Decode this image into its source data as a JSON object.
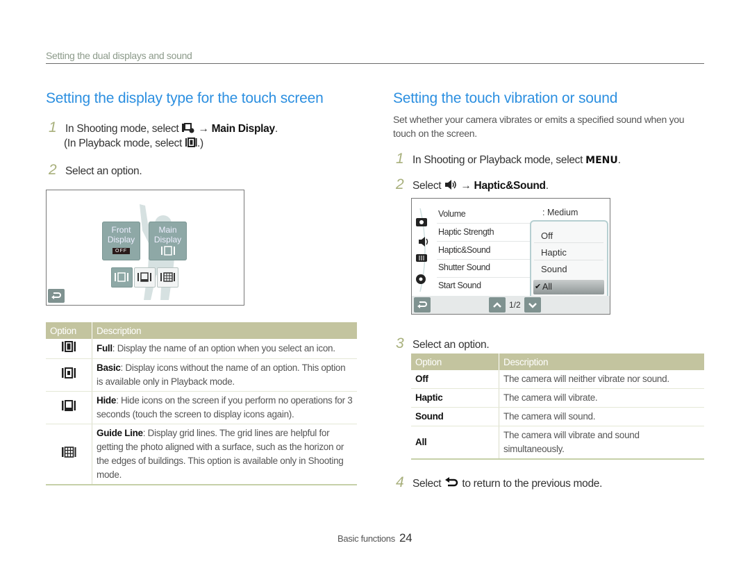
{
  "page": {
    "section_header": "Setting the dual displays and sound",
    "footer": {
      "label": "Basic functions",
      "page_number": "24"
    }
  },
  "left": {
    "title": "Setting the display type for the touch screen",
    "steps": [
      {
        "num": "1",
        "text_a": "In Shooting mode, select",
        "arrow": "→",
        "bold": "Main Display",
        "end": ".",
        "line2_a": "(In Playback mode, select",
        "line2_end": ".)"
      },
      {
        "num": "2",
        "text": "Select an option."
      }
    ],
    "screen": {
      "tiles": [
        {
          "label_1": "Front",
          "label_2": "Display",
          "badge": "OFF"
        },
        {
          "label_1": "Main",
          "label_2": "Display"
        }
      ],
      "option_icons": [
        "full-display-icon",
        "hide-display-icon",
        "guide-line-icon"
      ],
      "back_icon": "back-icon"
    },
    "table": {
      "headers": [
        "Option",
        "Description"
      ],
      "rows": [
        {
          "icon": "full-display-icon",
          "bold": "Full",
          "text": ": Display the name of an option when you select an icon."
        },
        {
          "icon": "basic-display-icon",
          "bold": "Basic",
          "text": ": Display icons without the name of an option. This option is available only in Playback mode."
        },
        {
          "icon": "hide-display-icon",
          "bold": "Hide",
          "text": ": Hide icons on the screen if you perform no operations for 3 seconds (touch the screen to display icons again)."
        },
        {
          "icon": "guide-line-icon",
          "bold": "Guide Line",
          "text": ": Display grid lines. The grid lines are helpful for getting the photo aligned with a surface, such as the horizon or the edges of buildings. This option is available only in Shooting mode."
        }
      ]
    }
  },
  "right": {
    "title": "Setting the touch vibration or sound",
    "intro": "Set whether your camera vibrates or emits a specified sound when you touch on the screen.",
    "steps": [
      {
        "num": "1",
        "text": "In Shooting or Playback mode, select",
        "glyph": "MENU",
        "end": "."
      },
      {
        "num": "2",
        "text": "Select",
        "arrow": "→",
        "bold": "Haptic&Sound",
        "end": "."
      },
      {
        "num": "3",
        "text": "Select an option."
      },
      {
        "num": "4",
        "text_a": "Select",
        "text_b": "to return to the previous mode."
      }
    ],
    "screen": {
      "menu_items": [
        "Volume",
        "Haptic Strength",
        "Haptic&Sound",
        "Shutter Sound",
        "Start Sound"
      ],
      "volume_value": ": Medium",
      "popup_options": [
        "Off",
        "Haptic",
        "Sound",
        "All"
      ],
      "selected_option": "All",
      "page_indicator": "1/2",
      "check": "✔"
    },
    "table": {
      "headers": [
        "Option",
        "Description"
      ],
      "rows": [
        {
          "option": "Off",
          "desc": "The camera will neither vibrate nor sound."
        },
        {
          "option": "Haptic",
          "desc": "The camera will vibrate."
        },
        {
          "option": "Sound",
          "desc": "The camera will sound."
        },
        {
          "option": "All",
          "desc": "The camera will vibrate and sound simultaneously."
        }
      ]
    }
  }
}
